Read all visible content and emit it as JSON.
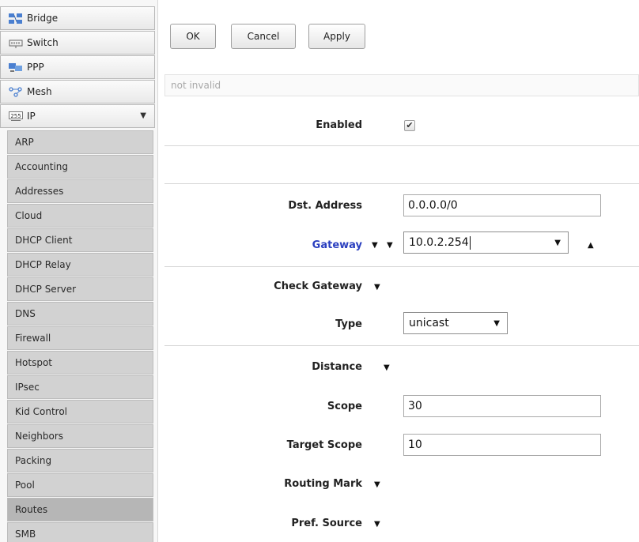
{
  "sidebar": {
    "top_items": [
      {
        "label": "Bridge",
        "icon": "bridge-icon"
      },
      {
        "label": "Switch",
        "icon": "switch-icon"
      },
      {
        "label": "PPP",
        "icon": "ppp-icon"
      },
      {
        "label": "Mesh",
        "icon": "mesh-icon"
      },
      {
        "label": "IP",
        "icon": "ip-icon",
        "icon_text": "255",
        "expanded_arrow": "▼"
      }
    ],
    "sub_items": [
      "ARP",
      "Accounting",
      "Addresses",
      "Cloud",
      "DHCP Client",
      "DHCP Relay",
      "DHCP Server",
      "DNS",
      "Firewall",
      "Hotspot",
      "IPsec",
      "Kid Control",
      "Neighbors",
      "Packing",
      "Pool",
      "Routes",
      "SMB"
    ],
    "active_item": "Routes"
  },
  "toolbar": {
    "ok_label": "OK",
    "cancel_label": "Cancel",
    "apply_label": "Apply"
  },
  "status_text": "not invalid",
  "form": {
    "enabled": {
      "label": "Enabled",
      "checked": true,
      "check_glyph": "✔"
    },
    "dst_address": {
      "label": "Dst. Address",
      "value": "0.0.0.0/0"
    },
    "gateway": {
      "label": "Gateway",
      "value": "10.0.2.254",
      "color": "#2a3fbf"
    },
    "check_gateway": {
      "label": "Check Gateway"
    },
    "type": {
      "label": "Type",
      "value": "unicast"
    },
    "distance": {
      "label": "Distance"
    },
    "scope": {
      "label": "Scope",
      "value": "30"
    },
    "target_scope": {
      "label": "Target Scope",
      "value": "10"
    },
    "routing_mark": {
      "label": "Routing Mark"
    },
    "pref_source": {
      "label": "Pref. Source"
    }
  },
  "glyphs": {
    "expand": "▼",
    "collapse": "▲",
    "dropdown": "▼"
  }
}
